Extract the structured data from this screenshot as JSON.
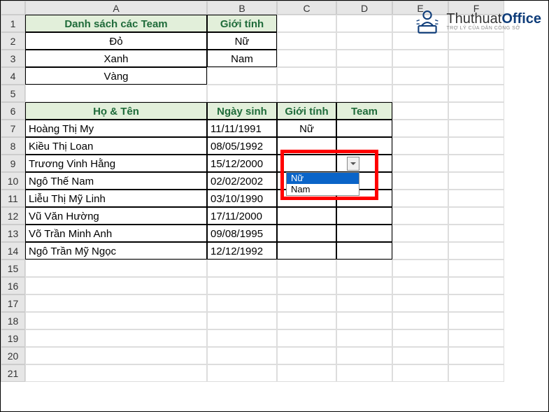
{
  "columns": [
    "A",
    "B",
    "C",
    "D",
    "E",
    "F"
  ],
  "rows": [
    "1",
    "2",
    "3",
    "4",
    "5",
    "6",
    "7",
    "8",
    "9",
    "10",
    "11",
    "12",
    "13",
    "14",
    "15",
    "16",
    "17",
    "18",
    "19",
    "20",
    "21"
  ],
  "headers1": {
    "A": "Danh sách các Team",
    "B": "Giới tính"
  },
  "teams": [
    "Đỏ",
    "Xanh",
    "Vàng"
  ],
  "genders": [
    "Nữ",
    "Nam"
  ],
  "headers2": {
    "A": "Họ & Tên",
    "B": "Ngày sinh",
    "C": "Giới tính",
    "D": "Team"
  },
  "people": [
    {
      "name": "Hoàng Thị My",
      "dob": "11/11/1991",
      "gender": "Nữ"
    },
    {
      "name": "Kiều Thị Loan",
      "dob": "08/05/1992",
      "gender": ""
    },
    {
      "name": "Trương Vinh Hằng",
      "dob": "15/12/2000",
      "gender": ""
    },
    {
      "name": "Ngô Thế Nam",
      "dob": "02/02/2002",
      "gender": ""
    },
    {
      "name": "Liễu Thị Mỹ Linh",
      "dob": "03/10/1990",
      "gender": ""
    },
    {
      "name": "Vũ Văn Hường",
      "dob": "17/11/2000",
      "gender": ""
    },
    {
      "name": "Võ Trần Minh Anh",
      "dob": "09/08/1995",
      "gender": ""
    },
    {
      "name": "Ngô Trần Mỹ Ngọc",
      "dob": "12/12/1992",
      "gender": ""
    }
  ],
  "dropdown": {
    "options": [
      "Nữ",
      "Nam"
    ],
    "selected": "Nữ"
  },
  "logo": {
    "brand1": "Thuthuat",
    "brand2": "Office",
    "tagline": "TRỢ LÝ CỦA DÂN CÔNG SỞ"
  }
}
